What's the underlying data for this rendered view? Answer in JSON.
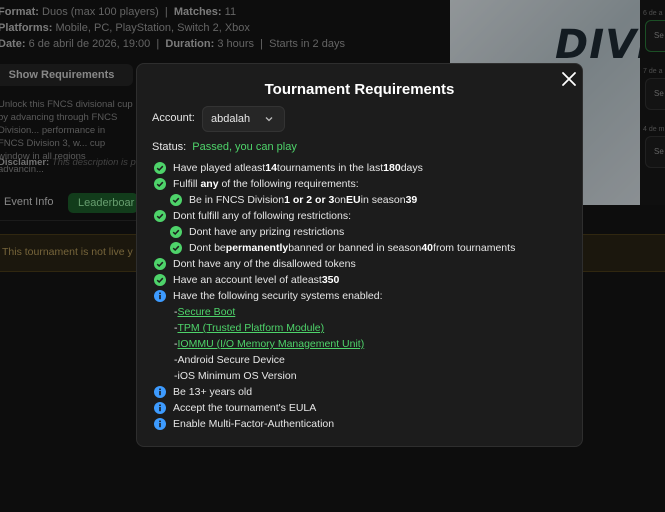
{
  "background": {
    "format_label": "Format:",
    "format_value": "Duos (max 100 players)",
    "matches_label": "Matches:",
    "matches_value": "11",
    "platforms_label": "Platforms:",
    "platforms_value": "Mobile, PC, PlayStation, Switch 2, Xbox",
    "date_label": "Date:",
    "date_value": "6 de abril de 2026, 19:00",
    "duration_label": "Duration:",
    "duration_value": "3 hours",
    "starts": "Starts in 2 days",
    "show_requirements": "Show Requirements",
    "description": "Unlock this FNCS divisional cup by advancing through FNCS Division... performance in FNCS Division 3, w... cup window in all regions advancin...",
    "disclaimer_label": "Disclaimer:",
    "disclaimer_text": "This description is pro...",
    "tab_event_info": "Event Info",
    "tab_leaderboard": "Leaderboar",
    "banner": "This tournament is not live y",
    "hero_text": "DIVI",
    "right_dates": [
      "6 de a",
      "7 de a",
      "4 de m"
    ],
    "right_boxes": [
      "Se",
      "Se",
      "Se"
    ]
  },
  "modal": {
    "title": "Tournament Requirements",
    "account_label": "Account:",
    "account_value": "abdalah",
    "status_label": "Status:",
    "status_value": "Passed, you can play",
    "requirements": {
      "r1_a": "Have played atleast ",
      "r1_b": "14",
      "r1_c": " tournaments in the last ",
      "r1_d": "180",
      "r1_e": " days",
      "r2_a": "Fulfill ",
      "r2_b": "any",
      "r2_c": " of the following requirements:",
      "r3_a": "Be in FNCS Division ",
      "r3_b": "1 or 2 or 3",
      "r3_c": " on ",
      "r3_d": "EU",
      "r3_e": " in season ",
      "r3_f": "39",
      "r4": "Dont fulfill any of following restrictions:",
      "r5": "Dont have any prizing restrictions",
      "r6_a": "Dont be ",
      "r6_b": "permanently",
      "r6_c": " banned or banned in season ",
      "r6_d": "40",
      "r6_e": " from tournaments",
      "r7": "Dont have any of the disallowed tokens",
      "r8_a": "Have an account level of atleast ",
      "r8_b": "350",
      "r9": "Have the following security systems enabled:",
      "s1": "Secure Boot",
      "s2": "TPM (Trusted Platform Module)",
      "s3": "IOMMU (I/O Memory Management Unit)",
      "s4": "Android Secure Device",
      "s5": "iOS Minimum OS Version",
      "dash": "- ",
      "r10": "Be 13+ years old",
      "r11": "Accept the tournament's EULA",
      "r12": "Enable Multi-Factor-Authentication"
    }
  },
  "colors": {
    "pass_green": "#4ed36a",
    "info_blue": "#3d9bff"
  },
  "icons": {
    "check": "check-circle-icon",
    "info": "info-circle-icon",
    "close": "close-icon",
    "chevron": "chevron-down-icon"
  }
}
